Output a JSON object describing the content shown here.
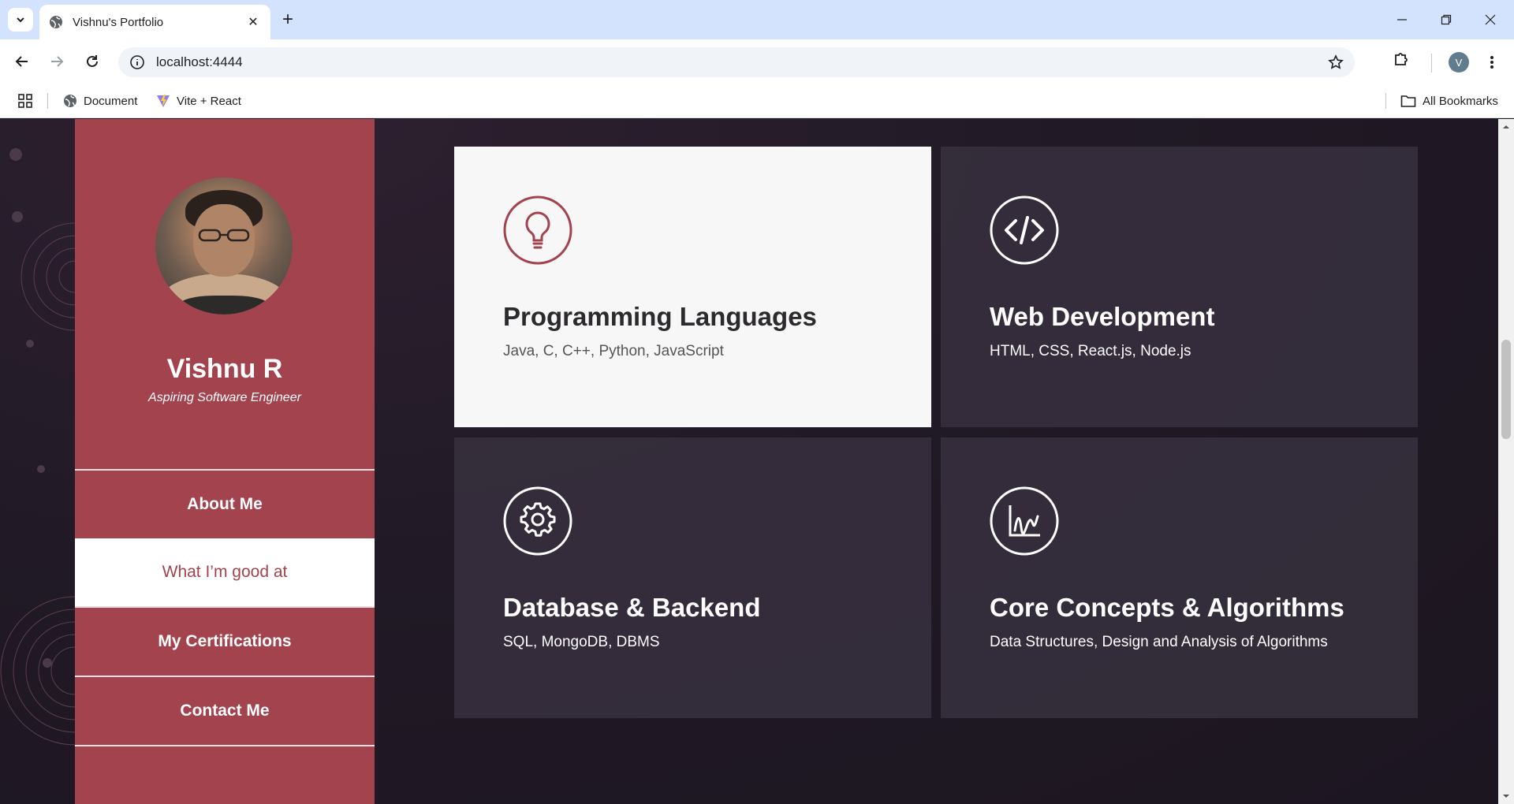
{
  "browser": {
    "tab_title": "Vishnu's Portfolio",
    "url": "localhost:4444",
    "bookmarks": [
      {
        "label": "Document",
        "icon": "globe-icon"
      },
      {
        "label": "Vite + React",
        "icon": "vite-icon"
      }
    ],
    "all_bookmarks": "All Bookmarks",
    "profile_initial": "V"
  },
  "sidebar": {
    "name": "Vishnu R",
    "role": "Aspiring Software Engineer",
    "nav": [
      {
        "label": "About Me",
        "active": false
      },
      {
        "label": "What I’m good at",
        "active": true
      },
      {
        "label": "My Certifications",
        "active": false
      },
      {
        "label": "Contact Me",
        "active": false
      }
    ]
  },
  "skills": [
    {
      "title": "Programming Languages",
      "desc": "Java, C, C++, Python, JavaScript",
      "icon": "lightbulb-icon",
      "highlighted": true
    },
    {
      "title": "Web Development",
      "desc": "HTML, CSS, React.js, Node.js",
      "icon": "code-icon",
      "highlighted": false
    },
    {
      "title": "Database & Backend",
      "desc": "SQL, MongoDB, DBMS",
      "icon": "gear-icon",
      "highlighted": false
    },
    {
      "title": "Core Concepts & Algorithms",
      "desc": "Data Structures, Design and Analysis of Algorithms",
      "icon": "chart-icon",
      "highlighted": false
    }
  ],
  "colors": {
    "accent": "#a3434e",
    "page_bg": "#211a26",
    "card_bg": "#3a3240",
    "card_highlight": "#f7f7f8"
  }
}
